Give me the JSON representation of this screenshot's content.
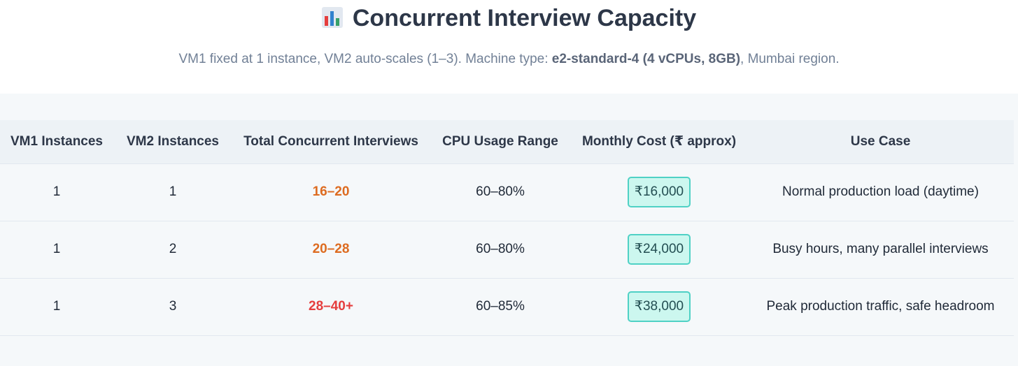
{
  "header": {
    "icon": "bar-chart-icon",
    "title": "Concurrent Interview Capacity",
    "subtitle_pre": "VM1 fixed at 1 instance, VM2 auto-scales (1–3). Machine type: ",
    "subtitle_bold": "e2-standard-4 (4 vCPUs, 8GB)",
    "subtitle_post": ", Mumbai region."
  },
  "table": {
    "columns": [
      "VM1 Instances",
      "VM2 Instances",
      "Total Concurrent Interviews",
      "CPU Usage Range",
      "Monthly Cost (₹ approx)",
      "Use Case"
    ],
    "rows": [
      {
        "vm1": "1",
        "vm2": "1",
        "concurrent": "16–20",
        "concurrent_color": "#dd6b20",
        "cpu": "60–80%",
        "cost": "₹16,000",
        "use_case": "Normal production load (daytime)"
      },
      {
        "vm1": "1",
        "vm2": "2",
        "concurrent": "20–28",
        "concurrent_color": "#dd6b20",
        "cpu": "60–80%",
        "cost": "₹24,000",
        "use_case": "Busy hours, many parallel interviews"
      },
      {
        "vm1": "1",
        "vm2": "3",
        "concurrent": "28–40+",
        "concurrent_color": "#e53e3e",
        "cpu": "60–85%",
        "cost": "₹38,000",
        "use_case": "Peak production traffic, safe headroom"
      }
    ]
  },
  "colors": {
    "accent_teal": "#4fd1c5",
    "warning_orange": "#dd6b20",
    "danger_red": "#e53e3e"
  }
}
